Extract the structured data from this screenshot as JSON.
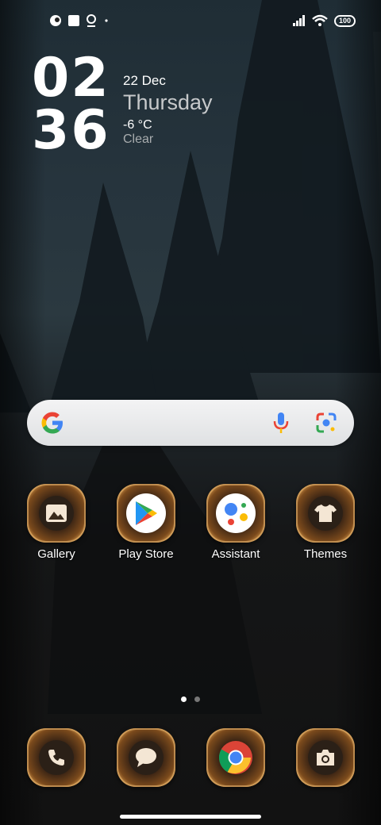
{
  "status_bar": {
    "battery": "100",
    "left_icons": [
      "app-notification-icon",
      "square-notification-icon",
      "location-pin-icon",
      "dot-icon"
    ],
    "right_icons": [
      "signal-icon",
      "wifi-icon"
    ]
  },
  "clock_widget": {
    "hours": "02",
    "minutes": "36",
    "date": "22 Dec",
    "day": "Thursday",
    "temperature": "-6 °C",
    "condition": "Clear"
  },
  "search_bar": {
    "icons": [
      "google-logo",
      "mic-icon",
      "lens-icon"
    ]
  },
  "apps": [
    {
      "label": "Gallery",
      "icon": "gallery-icon"
    },
    {
      "label": "Play Store",
      "icon": "play-store-icon"
    },
    {
      "label": "Assistant",
      "icon": "assistant-icon"
    },
    {
      "label": "Themes",
      "icon": "themes-icon"
    }
  ],
  "dock": [
    {
      "icon": "phone-icon"
    },
    {
      "icon": "messages-icon"
    },
    {
      "icon": "chrome-icon"
    },
    {
      "icon": "camera-icon"
    }
  ],
  "page_indicator": {
    "pages": 2,
    "active": 0
  }
}
